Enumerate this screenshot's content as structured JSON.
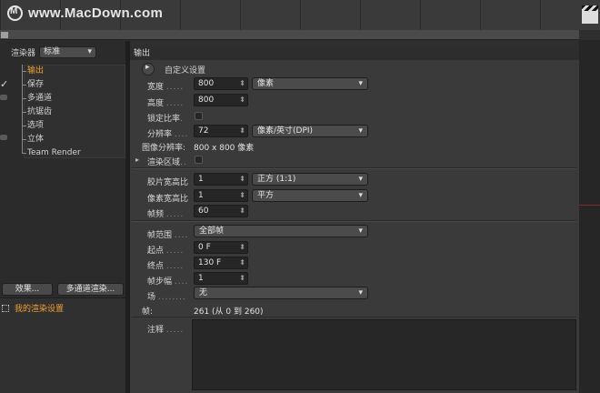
{
  "watermark": {
    "text": "www.MacDown.com"
  },
  "left": {
    "renderer_label": "渲染器",
    "renderer_value": "标准",
    "tree": [
      {
        "label": "输出",
        "active": true
      },
      {
        "label": "保存",
        "active": false
      },
      {
        "label": "多通道",
        "active": false
      },
      {
        "label": "抗锯齿",
        "active": false
      },
      {
        "label": "选项",
        "active": false
      },
      {
        "label": "立体",
        "active": false
      },
      {
        "label": "Team Render",
        "active": false
      }
    ],
    "effects_button": "效果...",
    "multipass_button": "多通道渲染...",
    "setting_name": "我的渲染设置"
  },
  "main": {
    "header": "输出",
    "preset_label": "自定义设置",
    "width_label": "宽度",
    "width_value": "800",
    "unit_value": "像素",
    "height_label": "高度",
    "height_value": "800",
    "lock_label": "锁定比率",
    "resolution_label": "分辨率",
    "resolution_value": "72",
    "resolution_unit": "像素/英寸(DPI)",
    "image_res_label": "图像分辨率:",
    "image_res_value": "800 x 800 像素",
    "region_label": "渲染区域",
    "film_aspect_label": "胶片宽高比",
    "film_aspect_value": "1",
    "film_aspect_preset": "正方 (1:1)",
    "pixel_aspect_label": "像素宽高比",
    "pixel_aspect_value": "1",
    "pixel_aspect_preset": "平方",
    "fps_label": "帧频",
    "fps_value": "60",
    "frame_range_label": "帧范围",
    "frame_range_value": "全部帧",
    "start_label": "起点",
    "start_value": "0 F",
    "end_label": "终点",
    "end_value": "130 F",
    "step_label": "帧步幅",
    "step_value": "1",
    "field_label": "场",
    "field_value": "无",
    "frames_label": "帧:",
    "frames_value": "261 (从 0 到 260)",
    "notes_label": "注释"
  },
  "colors": {
    "accent": "#f0a030",
    "panel": "#3a3a3a",
    "field": "#262626"
  }
}
